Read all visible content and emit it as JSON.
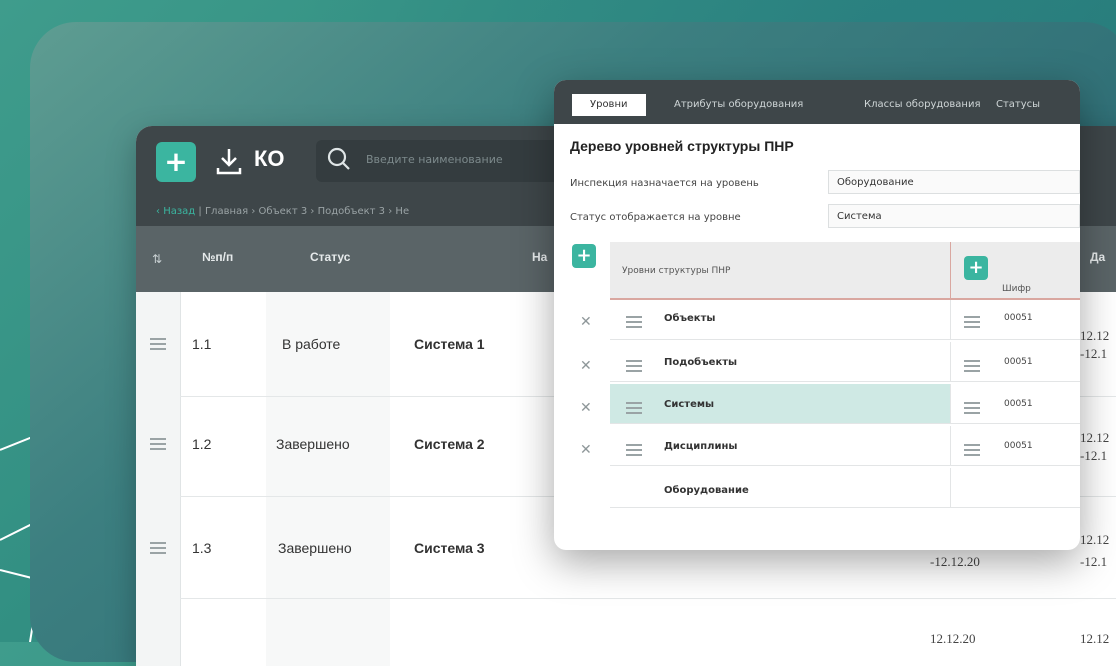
{
  "app": {
    "title": "КО",
    "search_placeholder": "Введите наименование",
    "breadcrumbs": [
      "Назад",
      "Главная",
      "Объект 3",
      "Подобъект 3",
      "Не"
    ]
  },
  "table": {
    "headers": [
      "№п/п",
      "Статус",
      "На",
      "Да"
    ],
    "rows": [
      {
        "num": "1.1",
        "status": "В работе",
        "name": "Система 1",
        "date_a": "",
        "date_b": "12.12",
        "date_c": "-12.1"
      },
      {
        "num": "1.2",
        "status": "Завершено",
        "name": "Система 2",
        "date_a": "",
        "date_b": "12.12",
        "date_c": "-12.1"
      },
      {
        "num": "1.3",
        "status": "Завершено",
        "name": "Система 3",
        "date_a": "-12.12.20",
        "date_b": "12.12",
        "date_c": "-12.1"
      },
      {
        "num": "",
        "status": "",
        "name": "",
        "date_a": "12.12.20",
        "date_b": "12.12",
        "date_c": ""
      }
    ]
  },
  "popup": {
    "tabs": [
      "Уровни",
      "Атрибуты оборудования",
      "Классы оборудования",
      "Статусы"
    ],
    "title": "Дерево уровней структуры ПНР",
    "fields": [
      {
        "label": "Инспекция назначается на уровень",
        "value": "Оборудование"
      },
      {
        "label": "Статус отображается на уровне",
        "value": "Система"
      }
    ],
    "tree_header": "Уровни структуры ПНР",
    "code_header": "Шифр",
    "levels": [
      {
        "name": "Объекты",
        "code": "00051"
      },
      {
        "name": "Подобъекты",
        "code": "00051"
      },
      {
        "name": "Системы",
        "code": "00051"
      },
      {
        "name": "Дисциплины",
        "code": "00051"
      },
      {
        "name": "Оборудование",
        "code": ""
      }
    ]
  },
  "colors": {
    "accent": "#3bb5a0",
    "header": "#3e4649",
    "selected_row": "#cfe9e4"
  }
}
